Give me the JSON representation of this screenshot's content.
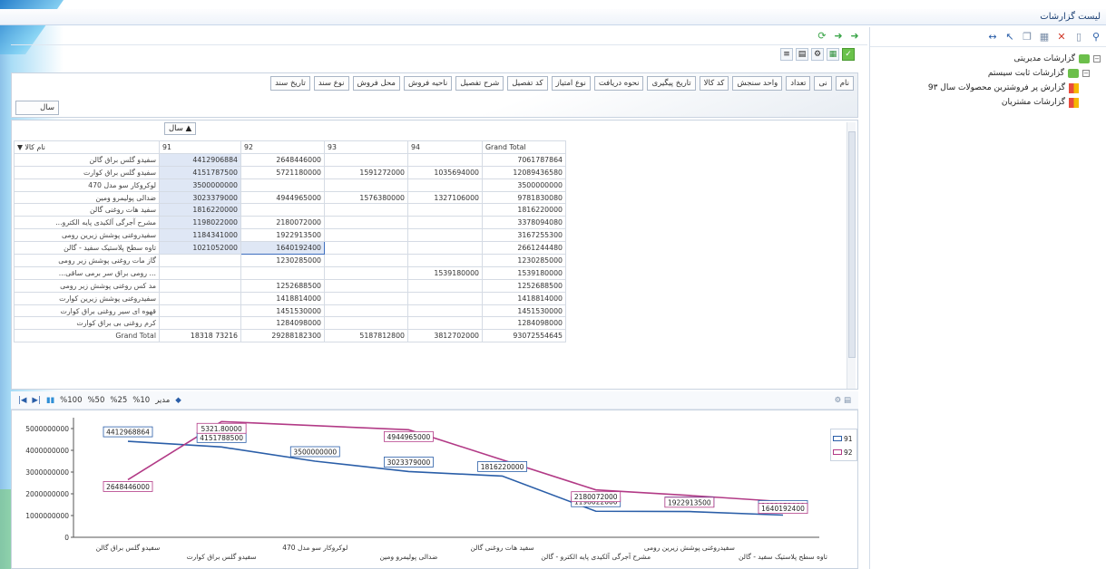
{
  "window": {
    "title": "لیست گزارشات"
  },
  "tree": {
    "items": [
      {
        "label": "گزارشات مدیریتی",
        "type": "folder",
        "level": 0
      },
      {
        "label": "گزارشات ثابت سیستم",
        "type": "folder",
        "level": 1
      },
      {
        "label": "گزارش پر فروشترین محصولات سال 9٣",
        "type": "report",
        "level": 2
      },
      {
        "label": "گزارشات مشتریان",
        "type": "report",
        "level": 2
      }
    ]
  },
  "fields": {
    "top_row": [
      "نام",
      "نی",
      "تعداد",
      "واحد سنجش",
      "کد کالا",
      "تاریخ پیگیری",
      "نحوه دریافت",
      "نوع امتیاز",
      "کد تفصیل",
      "شرح تفصیل",
      "ناحیه فروش",
      "محل فروش",
      "نوع سند",
      "تاریخ سند"
    ],
    "filter_left": "سال"
  },
  "pivot": {
    "row_field": "نام کالا",
    "col_headers": [
      "91",
      "92",
      "93",
      "94",
      "Grand Total"
    ],
    "rows": [
      {
        "name": "سفیدو گلس براق گالن",
        "v": [
          "4412906884",
          "2648446000",
          "",
          "",
          "7061787864"
        ]
      },
      {
        "name": "سفیدو گلس براق کوارت",
        "v": [
          "4151787500",
          "5721180000",
          "1591272000",
          "1035694000",
          "12089436580"
        ]
      },
      {
        "name": "لوکروکار سو مدل 470",
        "v": [
          "3500000000",
          "",
          "",
          "",
          "3500000000"
        ]
      },
      {
        "name": "ضدالی پولیمرو ومین",
        "v": [
          "3023379000",
          "4944965000",
          "1576380000",
          "1327106000",
          "9781830080"
        ]
      },
      {
        "name": "سفید هات روغنی گالن",
        "v": [
          "1816220000",
          "",
          "",
          "",
          "1816220000"
        ]
      },
      {
        "name": "مشرح آجرگی آلکیدی پایه الکترو...",
        "v": [
          "1198022000",
          "2180072000",
          "",
          "",
          "3378094080"
        ]
      },
      {
        "name": "سفیدروغنی پوشش زیرین رومی",
        "v": [
          "1184341000",
          "1922913500",
          "",
          "",
          "3167255300"
        ]
      },
      {
        "name": "تاوه سطح پلاستیک سفید - گالن",
        "v": [
          "1021052000",
          "1640192400",
          "",
          "",
          "2661244480"
        ]
      },
      {
        "name": "گاز مات روغنی پوشش زیر رومی",
        "v": [
          "",
          "1230285000",
          "",
          "",
          "1230285000"
        ]
      },
      {
        "name": "... رومی براق سر برمی ساقی...",
        "v": [
          "",
          "",
          "",
          "1539180000",
          "1539180000"
        ]
      },
      {
        "name": "مد کس روغنی پوشش زیر رومی",
        "v": [
          "",
          "1252688500",
          "",
          "",
          "1252688500"
        ]
      },
      {
        "name": "سفیدروغنی پوشش زیرین کوارت",
        "v": [
          "",
          "1418814000",
          "",
          "",
          "1418814000"
        ]
      },
      {
        "name": "قهوه ای سیر روغنی براق کوارت",
        "v": [
          "",
          "1451530000",
          "",
          "",
          "1451530000"
        ]
      },
      {
        "name": "کرم روغنی بی براق کوارت",
        "v": [
          "",
          "1284098000",
          "",
          "",
          "1284098000"
        ]
      },
      {
        "name": "Grand Total",
        "v": [
          "18318 73216",
          "29288182300",
          "5187812800",
          "3812702000",
          "93072554645"
        ]
      }
    ]
  },
  "chart_toolbar": {
    "zoom": [
      "%100",
      "%50",
      "%25",
      "%10"
    ],
    "mode": "مدیر"
  },
  "chart_data": {
    "type": "line",
    "categories": [
      "سفیدو گلس براق گالن",
      "سفیدو گلس براق کوارت",
      "لوکروکار سو مدل 470",
      "ضدالی پولیمرو ومین",
      "سفید هات روغنی گالن",
      "مشرح آجرگی آلکیدی",
      "سفیدروغنی پوشش زیرین رومی",
      "تاوه سطح پلاستیک سفید - گالن"
    ],
    "x_tick_labels": [
      "سفیدو گلس براق گالن",
      "سفیدو گلس براق کوارت",
      "لوکروکار سو مدل 470",
      "ضدالی پولیمرو ومین",
      "سفید هات روغنی گالن",
      "مشرح آجرگی آلکیدی پایه الکترو - گالن",
      "سفیدروغنی پوشش زیرین رومی",
      "تاوه سطح پلاستیک سفید - گالن"
    ],
    "series": [
      {
        "name": "91",
        "color": "#2a5ea8",
        "values": [
          4412968864,
          4151787500,
          3500000000,
          3023379000,
          2816220000,
          1198022000,
          1184341000,
          1021052000
        ]
      },
      {
        "name": "92",
        "color": "#b23a86",
        "values": [
          2648446000,
          5321800000,
          null,
          4944965000,
          null,
          2180072000,
          1922913500,
          1640192400
        ]
      }
    ],
    "point_labels_91": [
      "4412968864",
      "4151788500",
      "3500000000",
      "3023379000",
      "1816220000",
      "1198022000",
      "1184341000",
      "1021052000"
    ],
    "point_labels_92": [
      "2648446000",
      "5321.80000",
      "4944965000",
      "2180072000",
      "1922913500",
      "1640192400"
    ],
    "yticks": [
      "0",
      "1000000000",
      "2000000000",
      "3000000000",
      "4000000000",
      "5000000000"
    ],
    "ylim": [
      0,
      5500000000
    ],
    "legend": "right"
  }
}
